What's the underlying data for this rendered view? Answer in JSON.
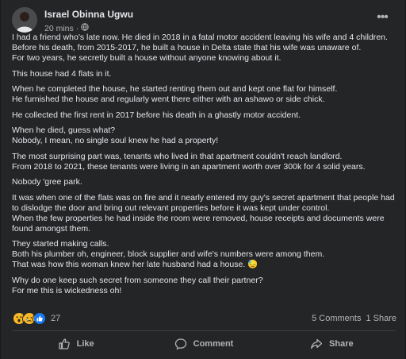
{
  "post": {
    "author": "Israel Obinna Ugwu",
    "time": "20 mins",
    "separator": "·",
    "privacy_icon": "globe-icon",
    "more_icon": "more-options-icon",
    "paragraphs": [
      [
        "I had a friend who's late now. He died in 2018 in a fatal motor accident leaving his wife and 4 children.",
        "Before his death, from 2015-2017, he built a house in Delta state that his wife was unaware of.",
        "For two years, he secretly built a house without anyone knowing about it."
      ],
      [
        "This house had 4 flats in it."
      ],
      [
        "When he completed the house, he started renting them out and kept one flat for himself.",
        "He furnished the house and regularly went there either with an ashawo or side chick."
      ],
      [
        "He collected the first rent in 2017 before his death in a ghastly motor accident."
      ],
      [
        "When he died, guess what?",
        "Nobody, I mean, no single soul knew he had a property!"
      ],
      [
        "The most surprising part was, tenants who lived in that apartment couldn't reach landlord.",
        "From 2018 to 2021, these tenants were living in an apartment worth over 300k for 4 solid years."
      ],
      [
        "Nobody 'gree park."
      ],
      [
        "It was when one of the flats was on fire and it nearly entered my guy's secret apartment that people had",
        "to dislodge the door and bring out relevant properties before it was kept under control.",
        "When the few properties he had inside the room were removed, house receipts and documents were",
        "found amongst them."
      ],
      [
        "They started  making calls.",
        "Both his plumber oh, engineer, block supplier and wife's numbers were among them.",
        "That was how this woman knew her late husband had a house. 😓"
      ],
      [
        "Why do one keep such secret from someone they call their partner?",
        "For me this is wickedness oh!"
      ]
    ]
  },
  "reactions": {
    "icons": [
      "wow-reaction-icon",
      "sad-reaction-icon",
      "like-reaction-icon"
    ],
    "count": "27",
    "comments": "5 Comments",
    "shares": "1 Share"
  },
  "actions": {
    "like": "Like",
    "comment": "Comment",
    "share": "Share"
  },
  "colors": {
    "background": "#18191a",
    "card": "#242526",
    "text": "#e4e6eb",
    "secondary": "#b0b3b8",
    "like_blue": "#1877f2",
    "emoji_yellow": "#f7b928"
  }
}
